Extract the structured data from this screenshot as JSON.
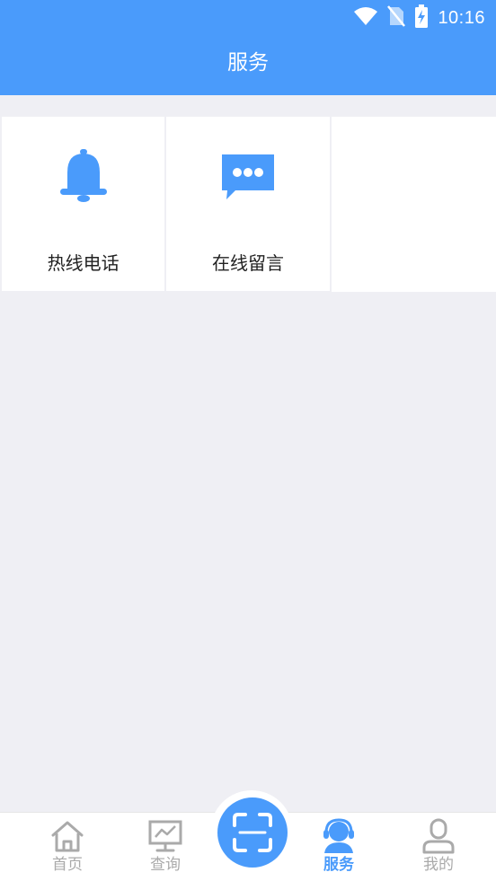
{
  "status_bar": {
    "time": "10:16"
  },
  "header": {
    "title": "服务"
  },
  "services": [
    {
      "label": "热线电话",
      "icon": "bell-icon"
    },
    {
      "label": "在线留言",
      "icon": "chat-bubble-icon"
    }
  ],
  "tabbar": {
    "tabs": [
      {
        "label": "首页",
        "icon": "home-icon"
      },
      {
        "label": "查询",
        "icon": "chart-icon"
      },
      {
        "label": "服务",
        "icon": "customer-service-icon",
        "active": true
      },
      {
        "label": "我的",
        "icon": "user-icon"
      }
    ],
    "scan_icon": "scan-icon"
  },
  "colors": {
    "primary": "#4a9bfb",
    "background": "#efeff4",
    "inactive": "#aaaaaa"
  }
}
